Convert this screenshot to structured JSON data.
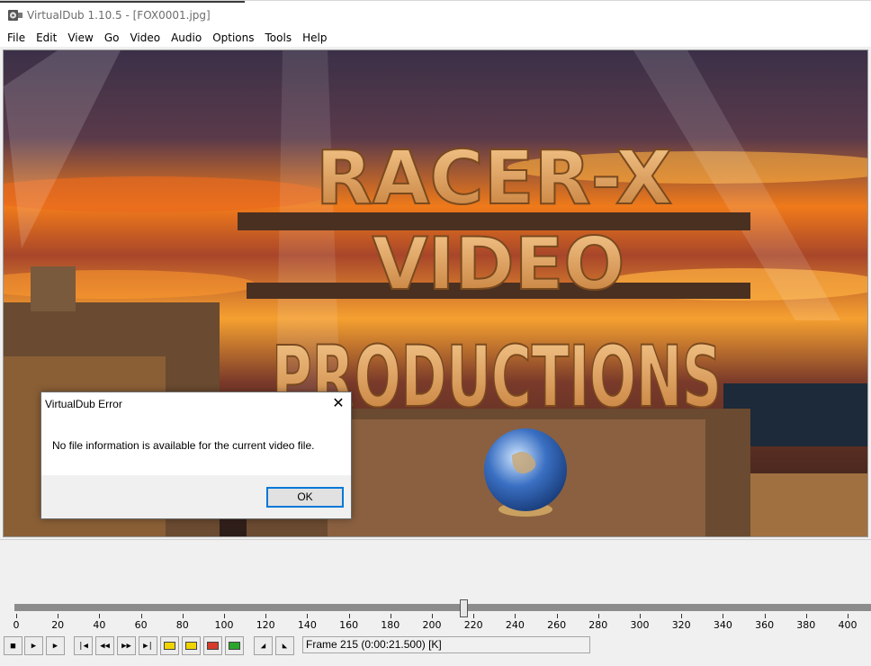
{
  "window": {
    "title": "VirtualDub 1.10.5 - [FOX0001.jpg]",
    "icon": "film-reel-icon"
  },
  "menu": [
    "File",
    "Edit",
    "View",
    "Go",
    "Video",
    "Audio",
    "Options",
    "Tools",
    "Help"
  ],
  "video": {
    "frame_text": [
      "RACER-X",
      "VIDEO",
      "PRODUCTIONS"
    ]
  },
  "timeline": {
    "labels": [
      "0",
      "20",
      "40",
      "60",
      "80",
      "100",
      "120",
      "140",
      "160",
      "180",
      "200",
      "220",
      "240",
      "260",
      "280",
      "300",
      "320",
      "340",
      "360",
      "380",
      "400"
    ],
    "current_frame": 215
  },
  "toolbar": {
    "buttons": [
      "stop-icon",
      "play-input-icon",
      "play-output-icon",
      "go-start-icon",
      "step-back-icon",
      "step-forward-icon",
      "go-end-icon",
      "prev-keyframe-icon",
      "next-keyframe-icon",
      "scene-back-icon",
      "scene-forward-icon",
      "mark-in-icon",
      "mark-out-icon"
    ],
    "frame_status": "Frame 215 (0:00:21.500) [K]"
  },
  "dialog": {
    "title": "VirtualDub Error",
    "message": "No file information is available for the current video file.",
    "ok_label": "OK",
    "close_icon": "close-icon"
  },
  "colors": {
    "dialog_focus": "#0078d7",
    "sky_orange": "#f07a1a",
    "letters": "#e9a85a"
  }
}
